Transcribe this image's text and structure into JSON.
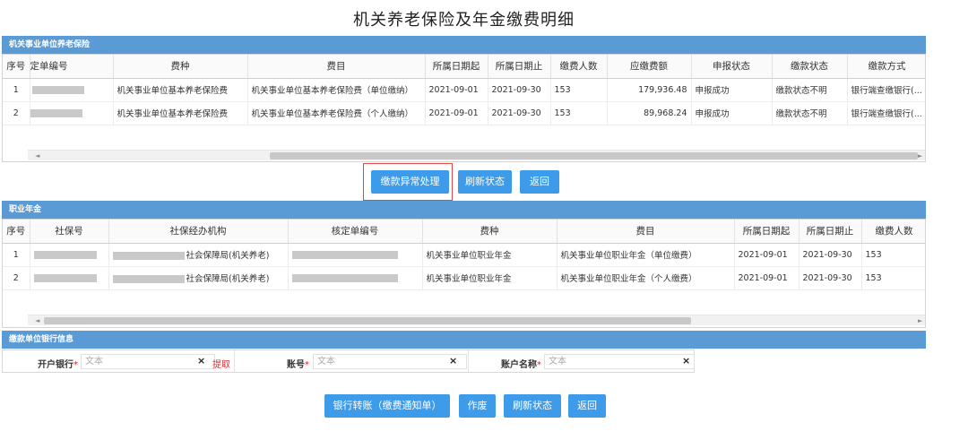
{
  "page_title": "机关养老保险及年金缴费明细",
  "section1": {
    "title": "机关事业单位养老保险",
    "columns": [
      "序号",
      "定单编号",
      "费种",
      "费目",
      "所属日期起",
      "所属日期止",
      "缴费人数",
      "应缴费额",
      "申报状态",
      "缴款状态",
      "缴款方式"
    ],
    "rows": [
      {
        "seq": "1",
        "fee_type": "机关事业单位基本养老保险费",
        "fee_item": "机关事业单位基本养老保险费（单位缴纳）",
        "date_from": "2021-09-01",
        "date_to": "2021-09-30",
        "persons": "153",
        "amount": "179,936.48",
        "declare_status": "申报成功",
        "pay_status": "缴款状态不明",
        "pay_method": "银行端查缴银行(..."
      },
      {
        "seq": "2",
        "fee_type": "机关事业单位基本养老保险费",
        "fee_item": "机关事业单位基本养老保险费（个人缴纳）",
        "date_from": "2021-09-01",
        "date_to": "2021-09-30",
        "persons": "153",
        "amount": "89,968.24",
        "declare_status": "申报成功",
        "pay_status": "缴款状态不明",
        "pay_method": "银行端查缴银行(..."
      }
    ],
    "buttons": {
      "exception": "缴款异常处理",
      "refresh": "刷新状态",
      "back": "返回"
    }
  },
  "section2": {
    "title": "职业年金",
    "columns": [
      "序号",
      "社保号",
      "社保经办机构",
      "核定单编号",
      "费种",
      "费目",
      "所属日期起",
      "所属日期止",
      "缴费人数"
    ],
    "rows": [
      {
        "seq": "1",
        "agency_suffix": "社会保障局(机关养老)",
        "fee_type": "机关事业单位职业年金",
        "fee_item": "机关事业单位职业年金（单位缴费）",
        "date_from": "2021-09-01",
        "date_to": "2021-09-30",
        "persons": "153"
      },
      {
        "seq": "2",
        "agency_suffix": "社会保障局(机关养老)",
        "fee_type": "机关事业单位职业年金",
        "fee_item": "机关事业单位职业年金（个人缴费）",
        "date_from": "2021-09-01",
        "date_to": "2021-09-30",
        "persons": "153"
      }
    ]
  },
  "section3": {
    "title": "缴款单位银行信息",
    "bank_label": "开户银行",
    "account_label": "账号",
    "account_name_label": "账户名称",
    "required_mark": "*",
    "placeholder": "文本",
    "fetch_label": "提取",
    "clear_icon": "×"
  },
  "bottom_buttons": {
    "transfer": "银行转账（缴费通知单）",
    "void": "作废",
    "refresh": "刷新状态",
    "back": "返回"
  }
}
